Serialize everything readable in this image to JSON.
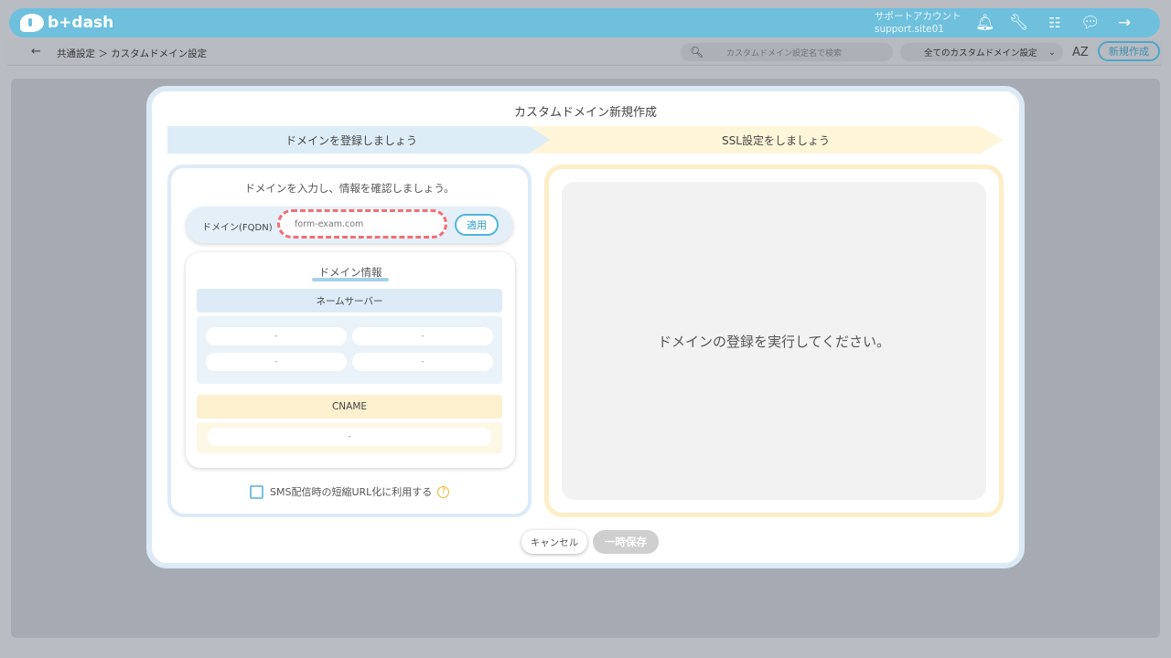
{
  "header": {
    "logo_text": "b+dash",
    "account_name": "サポートアカウント",
    "account_id": "support.site01",
    "icons": [
      "bell-icon",
      "wrench-icon",
      "grid-icon",
      "chat-icon",
      "logout-icon"
    ]
  },
  "subbar": {
    "breadcrumb": "共通設定 ＞ カスタムドメイン設定",
    "search_placeholder": "カスタムドメイン設定名で検索",
    "filter_selected": "全てのカスタムドメイン設定",
    "sort_label": "AZ",
    "new_button": "新規作成"
  },
  "modal": {
    "title": "カスタムドメイン新規作成",
    "steps": [
      "ドメインを登録しましょう",
      "SSL設定をしましょう"
    ],
    "instruction": "ドメインを入力し、情報を確認しましょう。",
    "domain_label": "ドメイン(FQDN)",
    "domain_value": "form-exam.com",
    "apply_label": "適用",
    "info_title": "ドメイン情報",
    "nameserver_header": "ネームサーバー",
    "nameservers": [
      "-",
      "-",
      "-",
      "-"
    ],
    "cname_header": "CNAME",
    "cname_value": "-",
    "sms_label": "SMS配信時の短縮URL化に利用する",
    "right_message": "ドメインの登録を実行してください。",
    "cancel_label": "キャンセル",
    "save_label": "一時保存"
  },
  "colors": {
    "header": "#6ec0dd",
    "accent": "#4fb5d8",
    "highlight_dashed": "#ef6f78",
    "step1_bg": "#ddedf8",
    "step2_bg": "#fff5d9"
  }
}
